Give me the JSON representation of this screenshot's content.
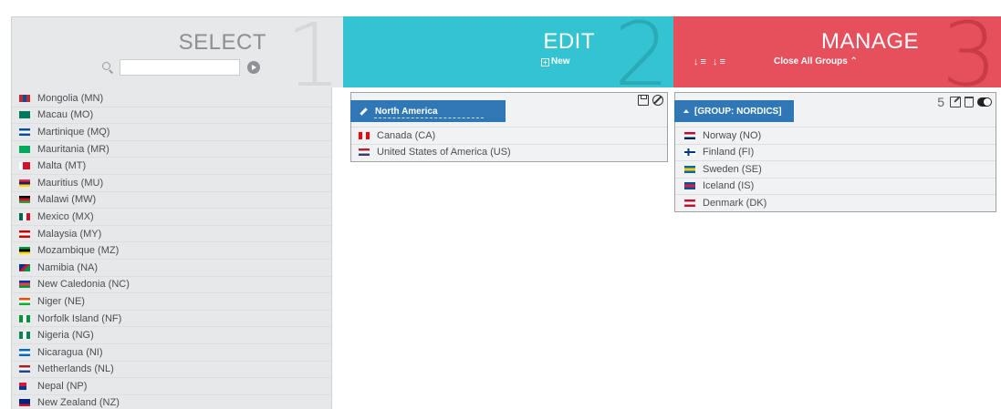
{
  "header": {
    "select": {
      "title": "SELECT",
      "step": "1",
      "search_placeholder": ""
    },
    "edit": {
      "title": "EDIT",
      "step": "2",
      "new_label": "New"
    },
    "manage": {
      "title": "MANAGE",
      "step": "3",
      "sort_labels": "↓≡ ↓≡",
      "close_groups_label": "Close All Groups ⌃"
    }
  },
  "select_list": [
    {
      "label": "Mongolia (MN)",
      "flag": [
        "#c4272f",
        "#015197",
        "#c4272f"
      ],
      "dir": "v"
    },
    {
      "label": "Macau (MO)",
      "flag": [
        "#00785e",
        "#00785e",
        "#00785e"
      ],
      "dir": "h"
    },
    {
      "label": "Martinique (MQ)",
      "flag": [
        "#0a4fa0",
        "#ffffff",
        "#0a4fa0"
      ],
      "dir": "h"
    },
    {
      "label": "Mauritania (MR)",
      "flag": [
        "#00a95c",
        "#00a95c",
        "#00a95c"
      ],
      "dir": "h"
    },
    {
      "label": "Malta (MT)",
      "flag": [
        "#ffffff",
        "#cf142b",
        "#cf142b"
      ],
      "dir": "v"
    },
    {
      "label": "Mauritius (MU)",
      "flag": [
        "#ea2839",
        "#1a206d",
        "#ffd500"
      ],
      "dir": "h"
    },
    {
      "label": "Malawi (MW)",
      "flag": [
        "#000000",
        "#ce1126",
        "#339e35"
      ],
      "dir": "h"
    },
    {
      "label": "Mexico (MX)",
      "flag": [
        "#006847",
        "#ffffff",
        "#ce1126"
      ],
      "dir": "v"
    },
    {
      "label": "Malaysia (MY)",
      "flag": [
        "#cc0001",
        "#ffffff",
        "#cc0001"
      ],
      "dir": "h"
    },
    {
      "label": "Mozambique (MZ)",
      "flag": [
        "#009a44",
        "#000000",
        "#fce100"
      ],
      "dir": "h"
    },
    {
      "label": "Namibia (NA)",
      "flag": [
        "#003580",
        "#d21034",
        "#009543"
      ],
      "dir": "d"
    },
    {
      "label": "New Caledonia (NC)",
      "flag": [
        "#0035ad",
        "#ed4135",
        "#009543"
      ],
      "dir": "h"
    },
    {
      "label": "Niger (NE)",
      "flag": [
        "#e05206",
        "#ffffff",
        "#0db02b"
      ],
      "dir": "h"
    },
    {
      "label": "Norfolk Island (NF)",
      "flag": [
        "#009639",
        "#ffffff",
        "#009639"
      ],
      "dir": "v"
    },
    {
      "label": "Nigeria (NG)",
      "flag": [
        "#008751",
        "#ffffff",
        "#008751"
      ],
      "dir": "v"
    },
    {
      "label": "Nicaragua (NI)",
      "flag": [
        "#0067c6",
        "#ffffff",
        "#0067c6"
      ],
      "dir": "h"
    },
    {
      "label": "Netherlands (NL)",
      "flag": [
        "#ae1c28",
        "#ffffff",
        "#21468b"
      ],
      "dir": "h"
    },
    {
      "label": "Nepal (NP)",
      "flag": [
        "#dc143c",
        "#003893",
        "#dc143c"
      ],
      "dir": "n"
    },
    {
      "label": "New Zealand (NZ)",
      "flag": [
        "#00247d",
        "#00247d",
        "#cc142b"
      ],
      "dir": "h"
    }
  ],
  "edit_card": {
    "group_name": "North America",
    "rows": [
      {
        "label": "Canada (CA)",
        "flag": [
          "#ff0000",
          "#ffffff",
          "#ff0000"
        ],
        "dir": "v"
      },
      {
        "label": "United States of America (US)",
        "flag": [
          "#b22234",
          "#ffffff",
          "#3c3b6e"
        ],
        "dir": "h"
      }
    ]
  },
  "manage_card": {
    "group_name": "[GROUP: NORDICS]",
    "count": "5",
    "rows": [
      {
        "label": "Norway (NO)",
        "flag": [
          "#ba0c2f",
          "#ffffff",
          "#00205b"
        ],
        "dir": "h"
      },
      {
        "label": "Finland (FI)",
        "flag": [
          "#ffffff",
          "#003580",
          "#ffffff"
        ],
        "dir": "c"
      },
      {
        "label": "Sweden (SE)",
        "flag": [
          "#006aa7",
          "#fecc00",
          "#006aa7"
        ],
        "dir": "h"
      },
      {
        "label": "Iceland (IS)",
        "flag": [
          "#02529c",
          "#dc1e35",
          "#02529c"
        ],
        "dir": "h"
      },
      {
        "label": "Denmark (DK)",
        "flag": [
          "#c8102e",
          "#ffffff",
          "#c8102e"
        ],
        "dir": "h"
      }
    ]
  }
}
